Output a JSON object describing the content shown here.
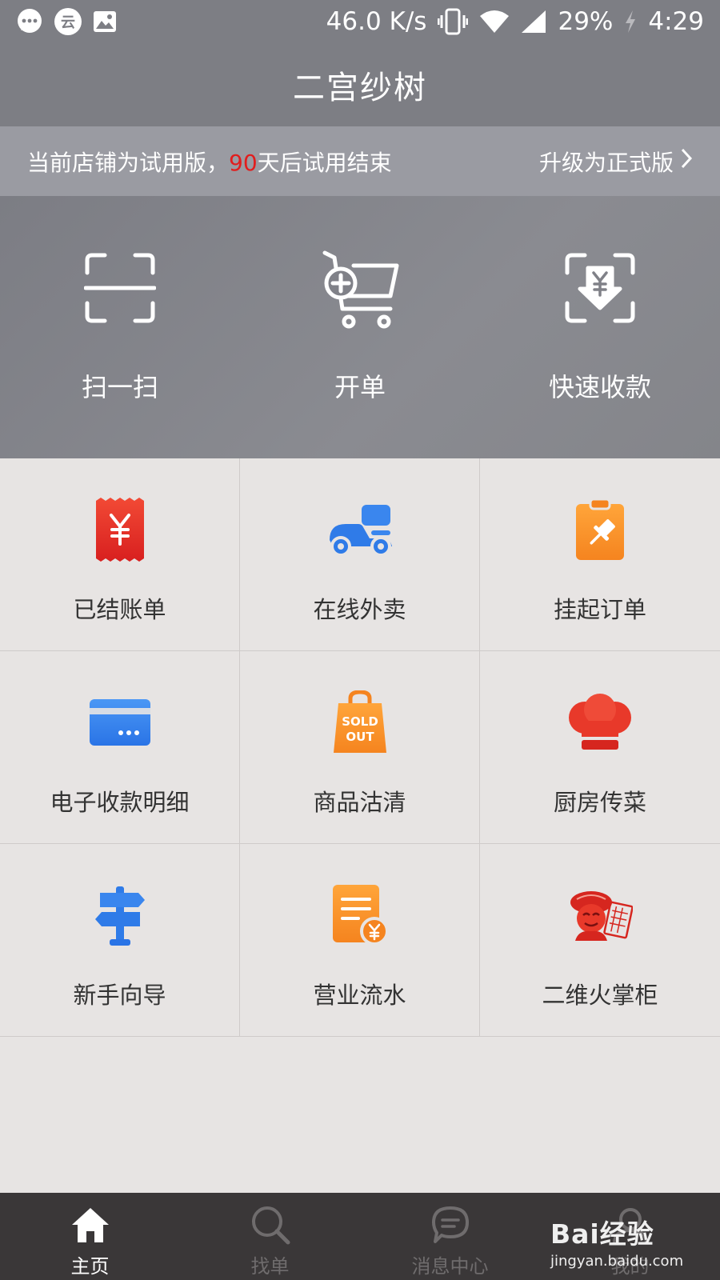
{
  "status_bar": {
    "speed": "46.0 K/s",
    "battery": "29%",
    "time": "4:29",
    "cloud_label": "云",
    "icons": [
      "message-icon",
      "cloud-icon",
      "image-icon",
      "vibrate-icon",
      "wifi-icon",
      "signal-icon",
      "charging-icon"
    ]
  },
  "header": {
    "title": "二宫纱树"
  },
  "trial_banner": {
    "prefix": "当前店铺为试用版，",
    "days": "90",
    "suffix": "天后试用结束",
    "upgrade_label": "升级为正式版"
  },
  "quick_actions": [
    {
      "label": "扫一扫",
      "icon": "scan-icon"
    },
    {
      "label": "开单",
      "icon": "cart-add-icon"
    },
    {
      "label": "快速收款",
      "icon": "quick-collect-icon"
    }
  ],
  "grid_items": [
    {
      "label": "已结账单",
      "icon": "receipt-icon"
    },
    {
      "label": "在线外卖",
      "icon": "scooter-icon"
    },
    {
      "label": "挂起订单",
      "icon": "clipboard-pin-icon"
    },
    {
      "label": "电子收款明细",
      "icon": "card-icon"
    },
    {
      "label": "商品沽清",
      "icon": "sold-out-bag-icon",
      "badge_top": "SOLD",
      "badge_bottom": "OUT"
    },
    {
      "label": "厨房传菜",
      "icon": "chef-hat-icon"
    },
    {
      "label": "新手向导",
      "icon": "signpost-icon"
    },
    {
      "label": "营业流水",
      "icon": "ledger-icon"
    },
    {
      "label": "二维火掌柜",
      "icon": "shopkeeper-icon"
    }
  ],
  "bottom_nav": [
    {
      "label": "主页",
      "icon": "home-icon",
      "active": true
    },
    {
      "label": "找单",
      "icon": "search-icon",
      "active": false
    },
    {
      "label": "消息中心",
      "icon": "chat-icon",
      "active": false
    },
    {
      "label": "我的",
      "icon": "profile-icon",
      "active": false
    }
  ],
  "watermark": {
    "brand": "Bai经验",
    "url": "jingyan.baidu.com"
  },
  "colors": {
    "header_bg": "#7d7e84",
    "banner_bg": "#9a9ba2",
    "accent_red": "#e21d1d",
    "grid_bg": "#e7e4e3",
    "nav_bg": "#3a3738"
  }
}
